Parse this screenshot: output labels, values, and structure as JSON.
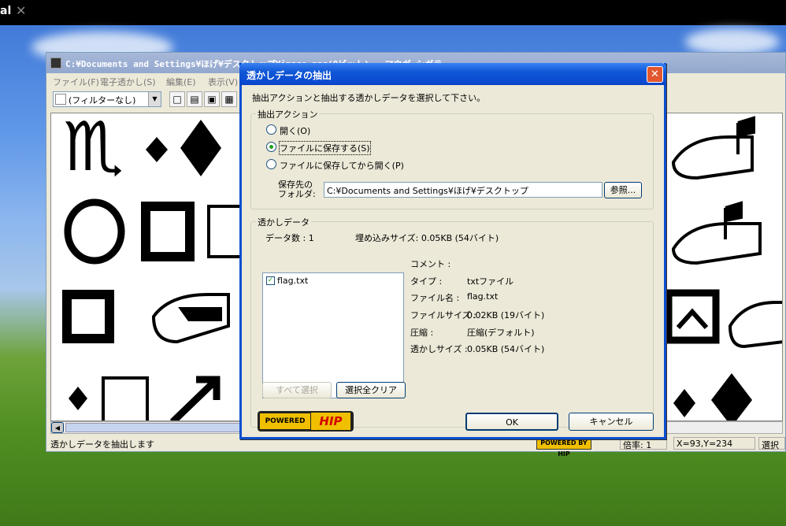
{
  "topbar": {
    "tab_text": "al",
    "close_glyph": "✕"
  },
  "main_window": {
    "title": "C:¥Documents and Settings¥ほげ¥デスクトップ¥image.png(0ビット) - マウガ シガラー",
    "menu": [
      "ファイル(F)",
      "電子透かし(S)",
      "編集(E)",
      "表示(V)"
    ],
    "filter_value": "(フィルターなし)",
    "status_left": "透かしデータを抽出します",
    "status_hip": "POWERED BY HIP",
    "status_zoom": "倍率: 1",
    "status_coords": "X=93,Y=234",
    "status_select": "選択"
  },
  "dialog": {
    "title": "透かしデータの抽出",
    "close_glyph": "✕",
    "instruction": "抽出アクションと抽出する透かしデータを選択して下さい。",
    "action_group_label": "抽出アクション",
    "radios": [
      {
        "label": "開く(O)",
        "selected": false
      },
      {
        "label": "ファイルに保存する(S)",
        "selected": true
      },
      {
        "label": "ファイルに保存してから開く(P)",
        "selected": false
      }
    ],
    "folder_label_1": "保存先の",
    "folder_label_2": "フォルダ:",
    "folder_value": "C:¥Documents and Settings¥ほげ¥デスクトップ",
    "browse_button": "参照...",
    "data_group_label": "透かしデータ",
    "data_count": "データ数 : 1",
    "embed_size": "埋め込みサイズ: 0.05KB (54バイト)",
    "list_items": [
      {
        "name": "flag.txt",
        "checked": true
      }
    ],
    "details": [
      {
        "key": "コメント :",
        "value": ""
      },
      {
        "key": "タイプ :",
        "value": "txtファイル"
      },
      {
        "key": "ファイル名 :",
        "value": "flag.txt"
      },
      {
        "key": "ファイルサイズ :",
        "value": "0.02KB (19バイト)"
      },
      {
        "key": "圧縮 :",
        "value": "圧縮(デフォルト)"
      },
      {
        "key": "透かしサイズ :",
        "value": "0.05KB (54バイト)"
      }
    ],
    "select_all_button": "すべて選択",
    "clear_all_button": "選択全クリア",
    "ok_button": "OK",
    "cancel_button": "キャンセル",
    "badge_left": "POWERED BY",
    "badge_right": "HIP"
  },
  "colors": {
    "dialog_title": "#0b4ad1",
    "close_red": "#e2572f",
    "badge_yellow": "#f0c000",
    "badge_red": "#d40000"
  }
}
